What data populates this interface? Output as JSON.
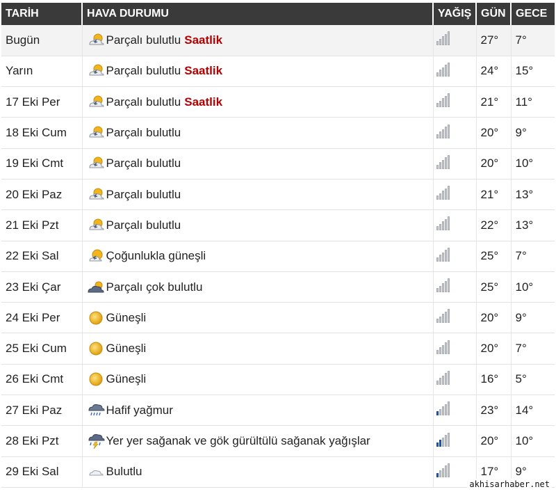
{
  "header": {
    "date": "TARİH",
    "condition": "HAVA DURUMU",
    "rain": "YAĞIŞ",
    "day": "GÜN",
    "night": "GECE"
  },
  "rows": [
    {
      "date": "Bugün",
      "icon": "partly-cloudy-icon",
      "condition": "Parçalı bulutlu",
      "link": "Saatlik",
      "rain_level": 0,
      "day": "27°",
      "night": "7°"
    },
    {
      "date": "Yarın",
      "icon": "partly-cloudy-icon",
      "condition": "Parçalı bulutlu",
      "link": "Saatlik",
      "rain_level": 0,
      "day": "24°",
      "night": "15°"
    },
    {
      "date": "17 Eki Per",
      "icon": "partly-cloudy-icon",
      "condition": "Parçalı bulutlu",
      "link": "Saatlik",
      "rain_level": 0,
      "day": "21°",
      "night": "11°"
    },
    {
      "date": "18 Eki Cum",
      "icon": "partly-cloudy-icon",
      "condition": "Parçalı bulutlu",
      "link": "",
      "rain_level": 0,
      "day": "20°",
      "night": "9°"
    },
    {
      "date": "19 Eki Cmt",
      "icon": "partly-cloudy-icon",
      "condition": "Parçalı bulutlu",
      "link": "",
      "rain_level": 0,
      "day": "20°",
      "night": "10°"
    },
    {
      "date": "20 Eki Paz",
      "icon": "partly-cloudy-icon",
      "condition": "Parçalı bulutlu",
      "link": "",
      "rain_level": 0,
      "day": "21°",
      "night": "13°"
    },
    {
      "date": "21 Eki Pzt",
      "icon": "partly-cloudy-icon",
      "condition": "Parçalı bulutlu",
      "link": "",
      "rain_level": 0,
      "day": "22°",
      "night": "13°"
    },
    {
      "date": "22 Eki Sal",
      "icon": "mostly-sunny-icon",
      "condition": "Çoğunlukla güneşli",
      "link": "",
      "rain_level": 0,
      "day": "25°",
      "night": "7°"
    },
    {
      "date": "23 Eki Çar",
      "icon": "mostly-cloudy-icon",
      "condition": "Parçalı çok bulutlu",
      "link": "",
      "rain_level": 0,
      "day": "25°",
      "night": "10°"
    },
    {
      "date": "24 Eki Per",
      "icon": "sun-icon",
      "condition": "Güneşli",
      "link": "",
      "rain_level": 0,
      "day": "20°",
      "night": "9°"
    },
    {
      "date": "25 Eki Cum",
      "icon": "sun-icon",
      "condition": "Güneşli",
      "link": "",
      "rain_level": 0,
      "day": "20°",
      "night": "7°"
    },
    {
      "date": "26 Eki Cmt",
      "icon": "sun-icon",
      "condition": "Güneşli",
      "link": "",
      "rain_level": 0,
      "day": "16°",
      "night": "5°"
    },
    {
      "date": "27 Eki Paz",
      "icon": "light-rain-icon",
      "condition": "Hafif yağmur",
      "link": "",
      "rain_level": 1,
      "day": "23°",
      "night": "14°"
    },
    {
      "date": "28 Eki Pzt",
      "icon": "thunderstorm-icon",
      "condition": "Yer yer sağanak ve gök gürültülü sağanak yağışlar",
      "link": "",
      "rain_level": 2,
      "day": "20°",
      "night": "10°"
    },
    {
      "date": "29 Eki Sal",
      "icon": "cloudy-icon",
      "condition": "Bulutlu",
      "link": "",
      "rain_level": 1,
      "day": "17°",
      "night": "9°"
    }
  ],
  "watermark": "akhisarhaber.net",
  "colors": {
    "header_bg": "#3a3a3a",
    "link": "#b40000",
    "rain_bar_on": "#1f5fb8",
    "rain_bar_off": "#c3c7cc"
  }
}
